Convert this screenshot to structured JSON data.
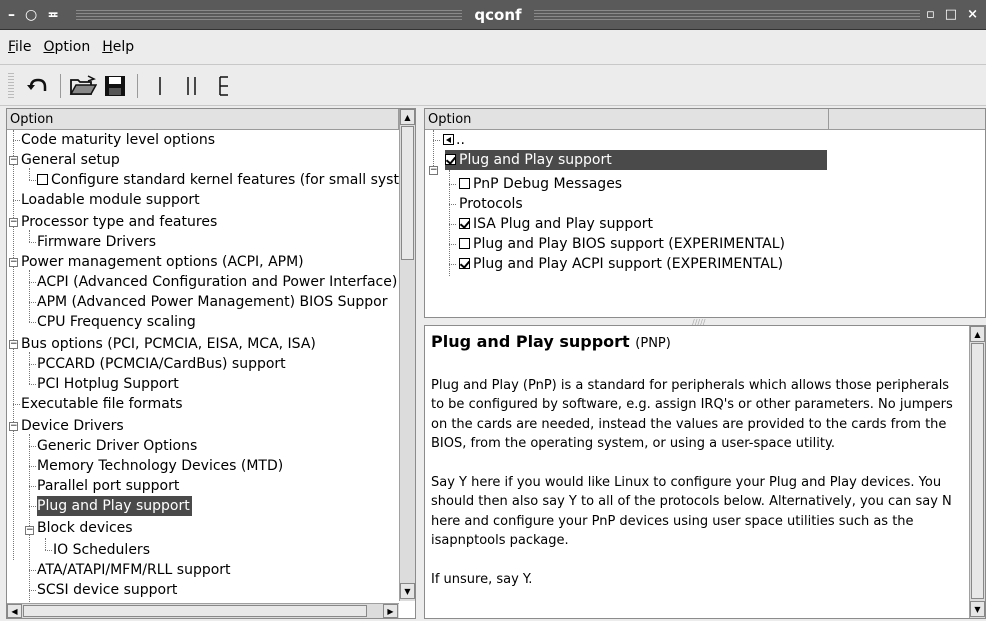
{
  "window": {
    "title": "qconf",
    "controls_left": [
      "–",
      "○",
      "≖"
    ],
    "controls_right": [
      "▫",
      "□",
      "×"
    ]
  },
  "menu": {
    "file": {
      "ul": "F",
      "rest": "ile"
    },
    "option": {
      "ul": "O",
      "rest": "ption"
    },
    "help": {
      "ul": "H",
      "rest": "elp"
    }
  },
  "toolbar": {
    "icons": [
      "back-icon",
      "open-folder-icon",
      "save-disk-icon",
      "single-view-icon",
      "split-view-icon",
      "full-view-icon"
    ]
  },
  "left_panel": {
    "header": "Option",
    "items": [
      "Code maturity level options",
      "General setup",
      "Configure standard kernel features (for small syst",
      "Loadable module support",
      "Processor type and features",
      "Firmware Drivers",
      "Power management options (ACPI, APM)",
      "ACPI (Advanced Configuration and Power Interface)",
      "APM (Advanced Power Management) BIOS Suppor",
      "CPU Frequency scaling",
      "Bus options (PCI, PCMCIA, EISA, MCA, ISA)",
      "PCCARD (PCMCIA/CardBus) support",
      "PCI Hotplug Support",
      "Executable file formats",
      "Device Drivers",
      "Generic Driver Options",
      "Memory Technology Devices (MTD)",
      "Parallel port support",
      "Plug and Play support",
      "Block devices",
      "IO Schedulers",
      "ATA/ATAPI/MFM/RLL support",
      "SCSI device support"
    ]
  },
  "right_top": {
    "header": "Option",
    "items": [
      "..",
      "Plug and Play support",
      "PnP Debug Messages",
      "Protocols",
      "ISA Plug and Play support",
      "Plug and Play BIOS support (EXPERIMENTAL)",
      "Plug and Play ACPI support (EXPERIMENTAL)"
    ]
  },
  "help": {
    "title": "Plug and Play support",
    "symbol": "(PNP)",
    "p1": "Plug and Play (PnP) is a standard for peripherals which allows those peripherals to be configured by software, e.g. assign IRQ's or other parameters. No jumpers on the cards are needed, instead the values are provided to the cards from the BIOS, from the operating system, or using a user-space utility.",
    "p2": "Say Y here if you would like Linux to configure your Plug and Play devices. You should then also say Y to all of the protocols below. Alternatively, you can say N here and configure your PnP devices using user space utilities such as the isapnptools package.",
    "p3": "If unsure, say Y."
  }
}
